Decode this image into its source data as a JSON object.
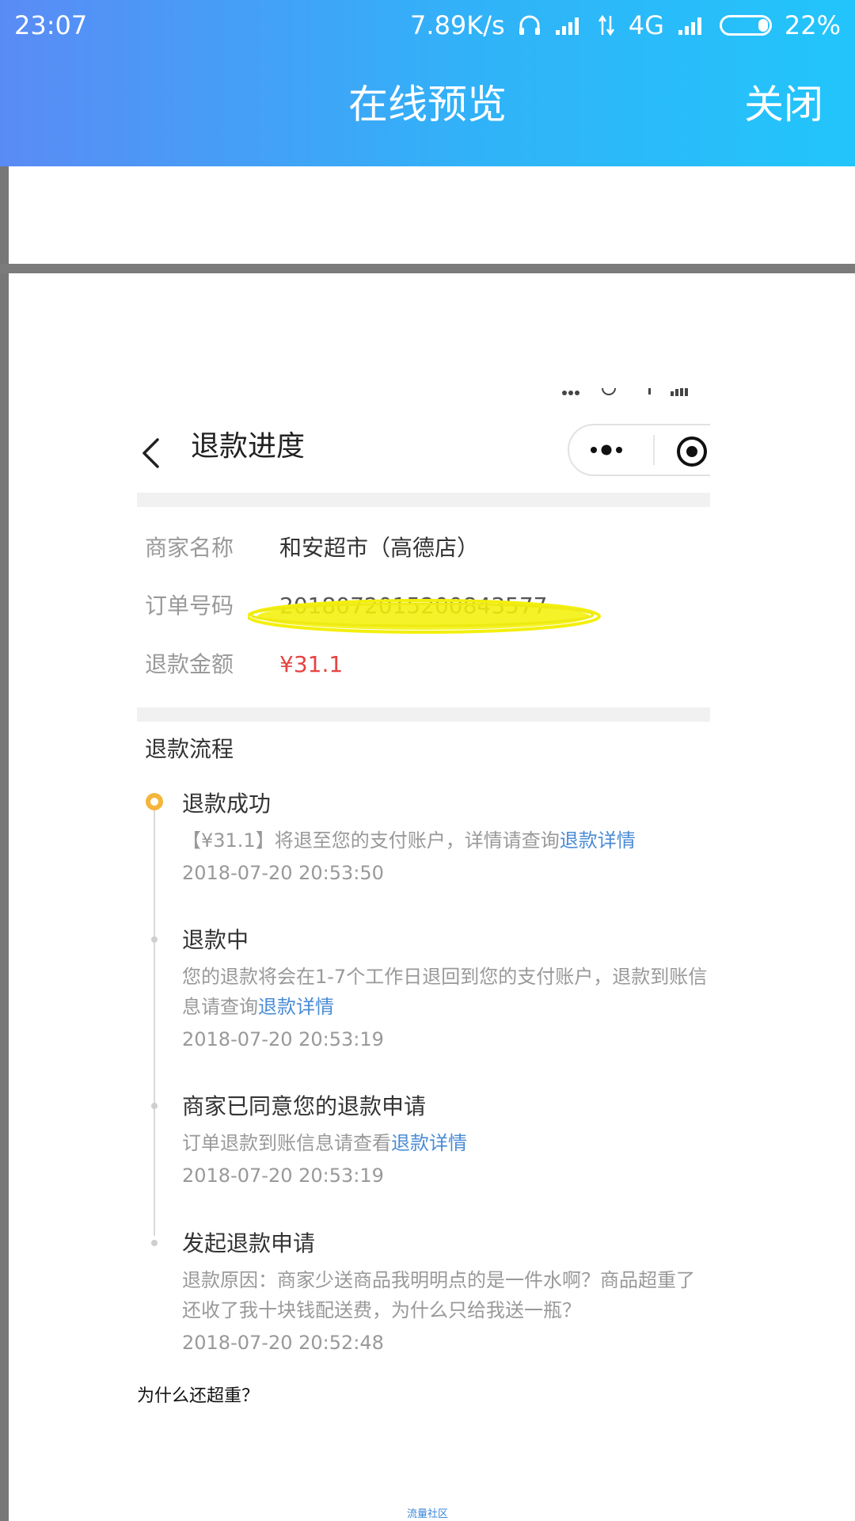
{
  "status_bar": {
    "time": "23:07",
    "net_speed": "7.89K/s",
    "network": "4G",
    "battery": "22%",
    "battery_level": 0.22
  },
  "title_bar": {
    "title": "在线预览",
    "close_label": "关闭"
  },
  "screenshot": {
    "title": "退款进度",
    "info": {
      "merchant_label": "商家名称",
      "merchant_value": "和安超市（高德店）",
      "order_label": "订单号码",
      "order_value": "2018072015200843577",
      "amount_label": "退款金额",
      "amount_value": "¥31.1"
    },
    "flow_title": "退款流程",
    "steps": [
      {
        "title": "退款成功",
        "desc": "【¥31.1】将退至您的支付账户，详情请查询",
        "link": "退款详情",
        "time": "2018-07-20 20:53:50"
      },
      {
        "title": "退款中",
        "desc": "您的退款将会在1-7个工作日退回到您的支付账户，退款到账信息请查询",
        "link": "退款详情",
        "time": "2018-07-20 20:53:19"
      },
      {
        "title": "商家已同意您的退款申请",
        "desc": "订单退款到账信息请查看",
        "link": "退款详情",
        "time": "2018-07-20 20:53:19"
      },
      {
        "title": "发起退款申请",
        "desc": "退款原因：商家少送商品我明明点的是一件水啊？商品超重了还收了我十块钱配送费，为什么只给我送一瓶？",
        "time": "2018-07-20 20:52:48"
      }
    ]
  },
  "caption": "为什么还超重？",
  "watermark": "流量社区",
  "colors": {
    "header_start": "#5a8bf5",
    "header_end": "#22c5fb",
    "amount": "#e64340",
    "link": "#4a8bd5",
    "timeline_active": "#f5b53c"
  }
}
